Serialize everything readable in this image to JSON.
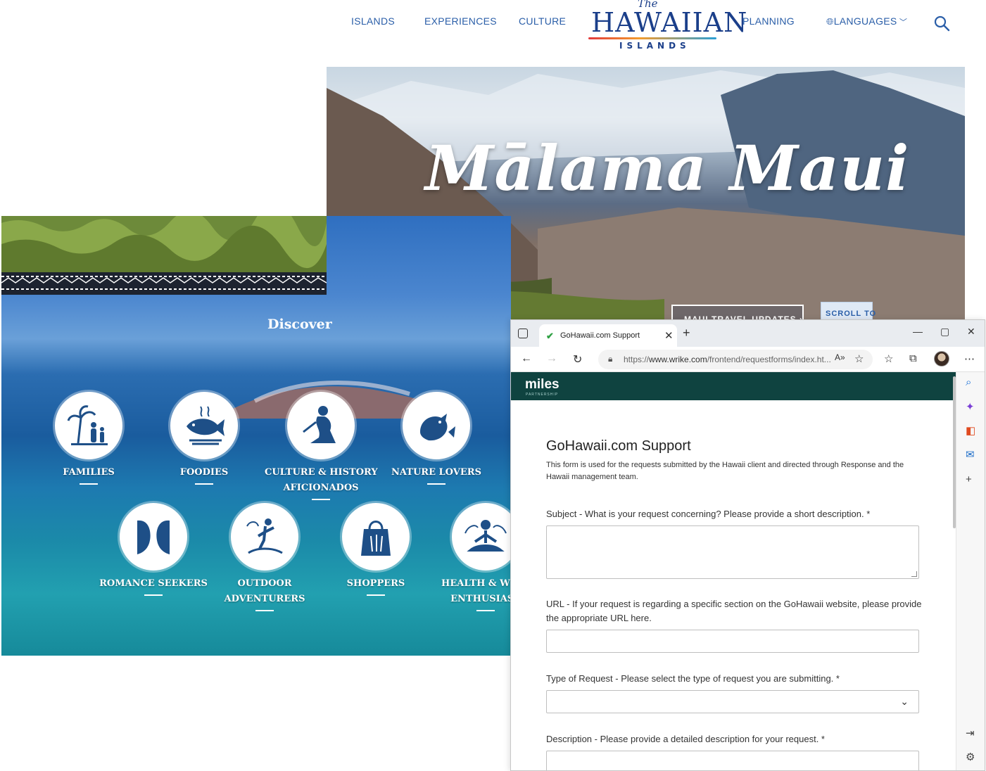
{
  "site": {
    "nav_left": [
      "ISLANDS",
      "EXPERIENCES",
      "CULTURE"
    ],
    "nav_right": [
      "PLANNING",
      "LANGUAGES"
    ],
    "logo": {
      "the": "The",
      "word": "HAWAIIAN",
      "islands": "ISLANDS"
    }
  },
  "hero": {
    "title": "Mālama Maui",
    "button_updates": "MAUI TRAVEL UPDATES ›",
    "button_scroll": "SCROLL TO"
  },
  "discover": {
    "title": "Discover",
    "categories": [
      {
        "line1": "FAMILIES",
        "line2": "",
        "icon": "families-icon"
      },
      {
        "line1": "FOODIES",
        "line2": "",
        "icon": "fish-icon"
      },
      {
        "line1": "CULTURE & HISTORY",
        "line2": "AFICIONADOS",
        "icon": "hula-icon"
      },
      {
        "line1": "NATURE LOVERS",
        "line2": "",
        "icon": "bird-icon"
      },
      {
        "line1": "ROMANCE SEEKERS",
        "line2": "",
        "icon": "couple-icon"
      },
      {
        "line1": "OUTDOOR",
        "line2": "ADVENTURERS",
        "icon": "surfer-icon"
      },
      {
        "line1": "SHOPPERS",
        "line2": "",
        "icon": "shopping-bag-icon"
      },
      {
        "line1": "HEALTH & WELL",
        "line2": "ENTHUSIAST",
        "icon": "meditation-icon"
      }
    ]
  },
  "browser": {
    "tab_title": "GoHawaii.com Support",
    "url_prefix": "https://",
    "url_host": "www.wrike.com",
    "url_path": "/frontend/requestforms/index.ht...",
    "brand": "miles",
    "brand_sub": "PARTNERSHIP"
  },
  "form": {
    "title": "GoHawaii.com Support",
    "description": "This form is used for the requests submitted by the Hawaii client and directed through Response and the Hawaii management team.",
    "subject_label": "Subject - What is your request concerning? Please provide a short description. *",
    "url_label": "URL - If your request is regarding a specific section on the GoHawaii website, please provide the appropriate URL here.",
    "type_label": "Type of Request - Please select the type of request you are submitting. *",
    "description_label": "Description - Please provide a detailed description for your request.  *"
  },
  "colors": {
    "nav_blue": "#2a5ea8",
    "brand_teal": "#0f4340",
    "logo_navy": "#1b3f8a"
  }
}
